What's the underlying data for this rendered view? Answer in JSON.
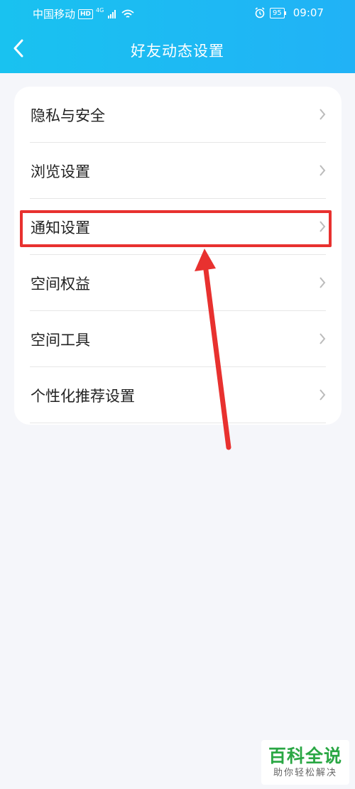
{
  "status_bar": {
    "carrier": "中国移动",
    "hd_badge": "HD",
    "network_type": "4G",
    "battery": "95",
    "time": "09:07"
  },
  "nav": {
    "back_icon": "chevron-left-icon",
    "title": "好友动态设置"
  },
  "settings_list": [
    {
      "label": "隐私与安全"
    },
    {
      "label": "浏览设置"
    },
    {
      "label": "通知设置"
    },
    {
      "label": "空间权益"
    },
    {
      "label": "空间工具"
    },
    {
      "label": "个性化推荐设置"
    }
  ],
  "annotation": {
    "highlight_color": "#e8312f",
    "highlighted_item": "通知设置"
  },
  "watermark": {
    "title": "百科全说",
    "subtitle": "助你轻松解决"
  },
  "colors": {
    "header_start": "#19c2f0",
    "header_end": "#21b2f6",
    "page_bg": "#f5f6fa",
    "chevron": "#bbbbbb"
  }
}
